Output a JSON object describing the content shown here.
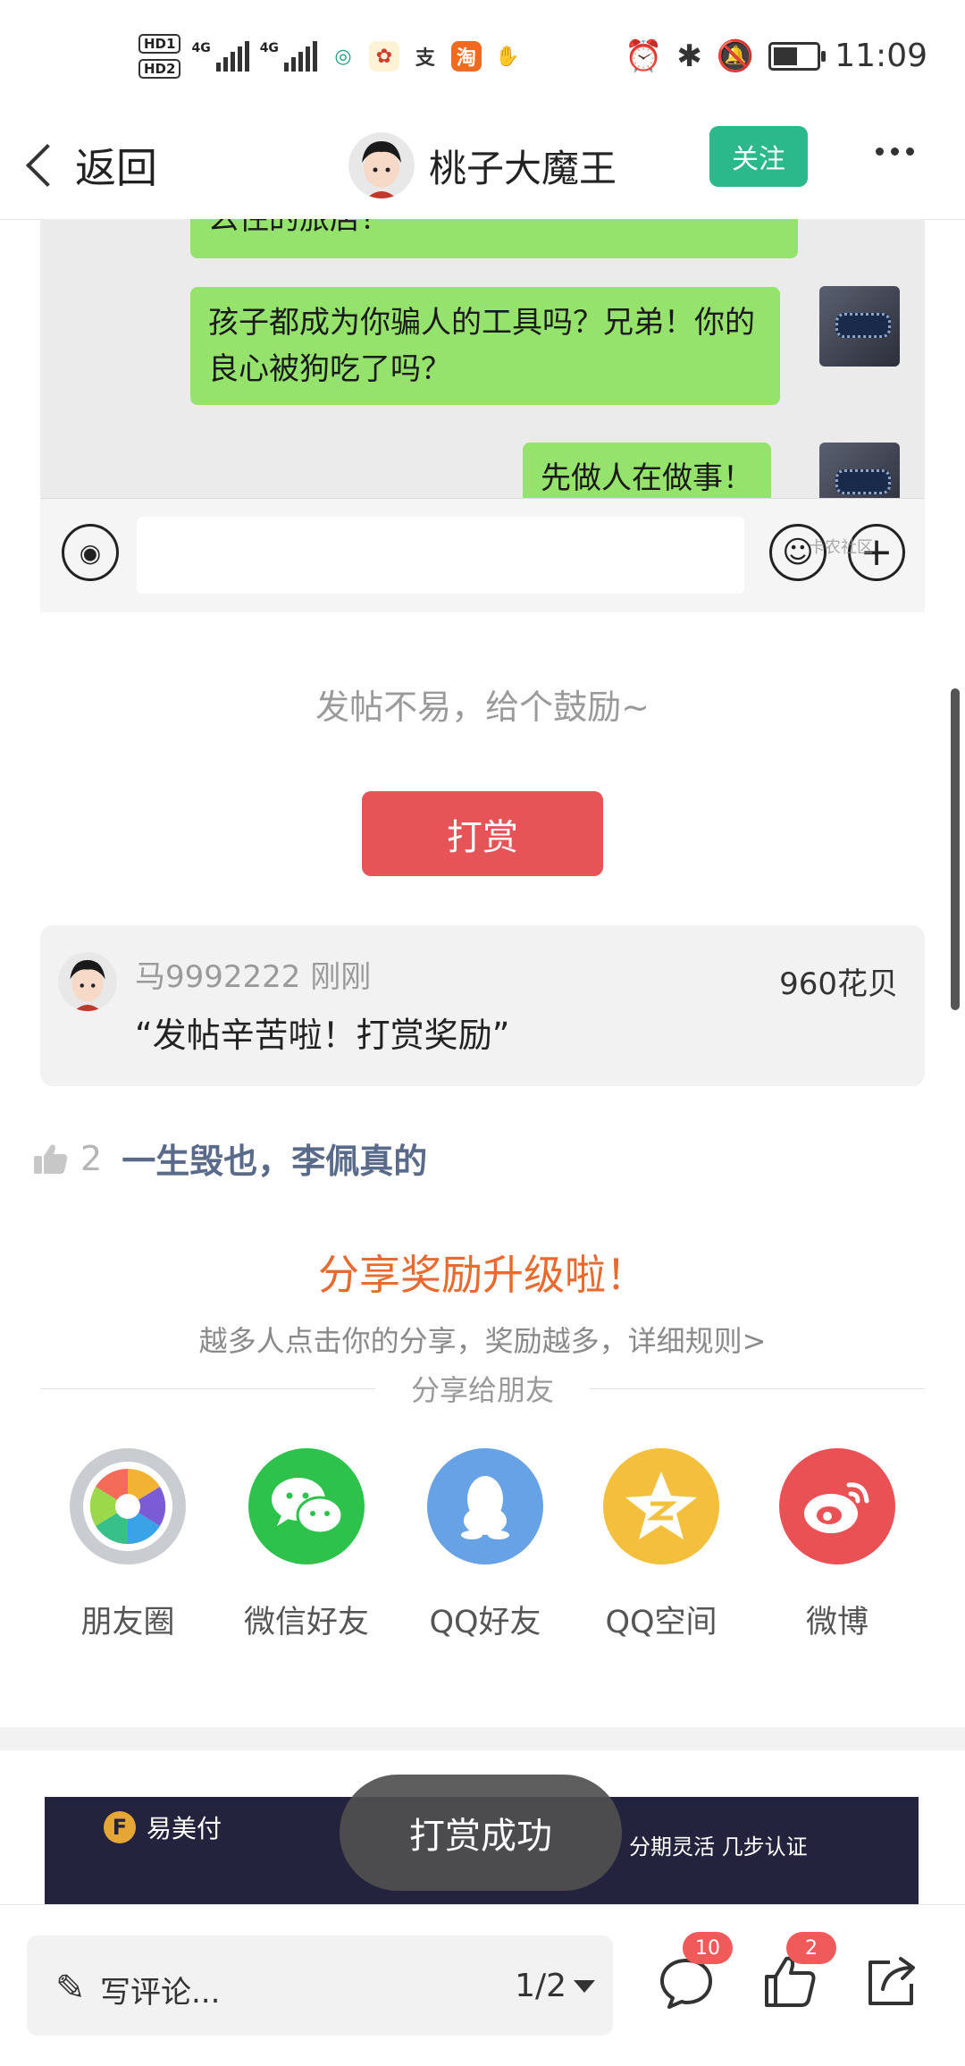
{
  "status_bar": {
    "hd_labels": [
      "HD1",
      "HD2"
    ],
    "network_labels": [
      "4G",
      "4G"
    ],
    "time": "11:09",
    "icons": [
      "hd-icon",
      "signal-icon",
      "signal-icon",
      "mobile-icon",
      "app-icon",
      "alipay-icon",
      "taobao-icon",
      "app-icon",
      "alarm-icon",
      "bluetooth-icon",
      "mute-icon",
      "battery-icon"
    ]
  },
  "header": {
    "back_label": "返回",
    "author_name": "桃子大魔王",
    "follow_label": "关注"
  },
  "chat": {
    "messages": [
      "么住的旅店？",
      "孩子都成为你骗人的工具吗？兄弟！你的良心被狗吃了吗？",
      "先做人在做事！"
    ],
    "watermark": "卡农社区"
  },
  "reward": {
    "encourage_text": "发帖不易，给个鼓励~",
    "button_label": "打赏",
    "record": {
      "user": "马9992222",
      "time": "刚刚",
      "amount": "960花贝",
      "message": "“发帖辛苦啦！打赏奖励”"
    }
  },
  "vote": {
    "count": "2",
    "text": "一生毁也，李佩真的"
  },
  "share": {
    "title": "分享奖励升级啦！",
    "subtitle": "越多人点击你的分享，奖励越多，详细规则>",
    "divider_label": "分享给朋友",
    "targets": [
      {
        "label": "朋友圈",
        "icon": "moments-icon",
        "color": "#c9cdd2"
      },
      {
        "label": "微信好友",
        "icon": "wechat-icon",
        "color": "#2dc24b"
      },
      {
        "label": "QQ好友",
        "icon": "qq-icon",
        "color": "#67a2e6"
      },
      {
        "label": "QQ空间",
        "icon": "qzone-icon",
        "color": "#f4bf3d"
      },
      {
        "label": "微博",
        "icon": "weibo-icon",
        "color": "#ea5155"
      }
    ]
  },
  "ad": {
    "brand": "易美付",
    "text": "分期灵活 几步认证"
  },
  "toast": "打赏成功",
  "bottom_bar": {
    "comment_placeholder": "写评论...",
    "page_indicator": "1/2",
    "comment_badge": "10",
    "like_badge": "2"
  },
  "colors": {
    "follow_green": "#2bb88a",
    "reward_red": "#e65458",
    "share_orange": "#e86a2e",
    "badge_red": "#f05a5a",
    "chat_bubble": "#95e36c"
  }
}
